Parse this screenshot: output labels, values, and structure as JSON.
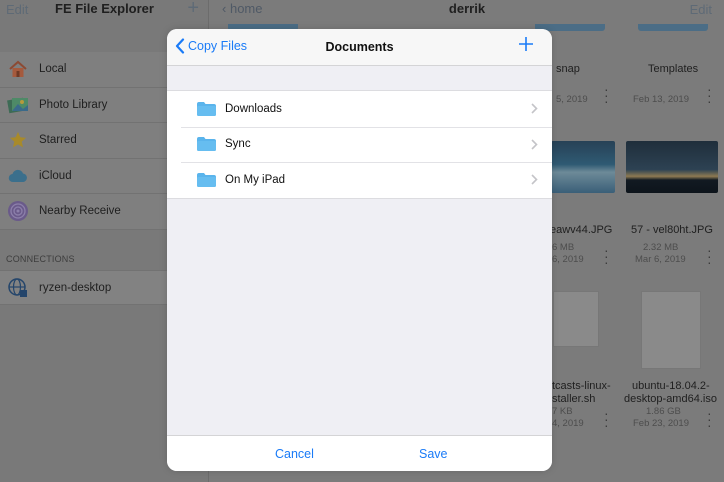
{
  "sidebar": {
    "edit_label": "Edit",
    "title": "FE File Explorer",
    "add_label": "+",
    "items": [
      {
        "label": "Local",
        "icon": "house-icon"
      },
      {
        "label": "Photo Library",
        "icon": "photos-icon"
      },
      {
        "label": "Starred",
        "icon": "star-icon"
      },
      {
        "label": "iCloud",
        "icon": "cloud-icon"
      },
      {
        "label": "Nearby Receive",
        "icon": "airdrop-icon"
      }
    ],
    "section_label": "CONNECTIONS",
    "connection": {
      "label": "ryzen-desktop",
      "icon": "network-globe-icon"
    }
  },
  "main": {
    "back_label": "home",
    "title": "derrik",
    "edit_label": "Edit",
    "files": [
      {
        "name": "snap",
        "meta": "",
        "date": "5, 2019"
      },
      {
        "name": "Templates",
        "meta": "",
        "date": "Feb 13, 2019"
      },
      {
        "name": "eawv44.JPG",
        "meta": "6 MB",
        "date": "6, 2019"
      },
      {
        "name": "57 - vel80ht.JPG",
        "meta": "2.32 MB",
        "date": "Mar 6, 2019"
      },
      {
        "name": "tcasts-linux-",
        "name2": "staller.sh",
        "meta": "7 KB",
        "date": "4, 2019"
      },
      {
        "name": "ubuntu-18.04.2-",
        "name2": "desktop-amd64.iso",
        "meta": "1.86 GB",
        "date": "Feb 23, 2019"
      }
    ]
  },
  "modal": {
    "back_label": "Copy Files",
    "title": "Documents",
    "add_icon": "plus-icon",
    "folders": [
      {
        "label": "Downloads"
      },
      {
        "label": "Sync"
      },
      {
        "label": "On My iPad"
      }
    ],
    "cancel_label": "Cancel",
    "save_label": "Save"
  },
  "colors": {
    "accent": "#1a7bf7",
    "folder": "#5ab4ec",
    "dim_overlay": "#7b7b7b"
  }
}
